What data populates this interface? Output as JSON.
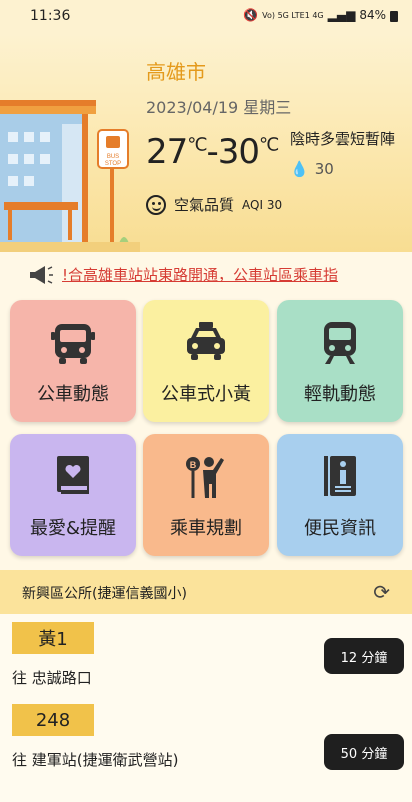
{
  "status_bar": {
    "time": "11:36",
    "signal_text": "Vo) 5G LTE1 4G",
    "battery": "84%"
  },
  "weather": {
    "city": "高雄市",
    "date": "2023/04/19 星期三",
    "temp_low": "27",
    "temp_high": "30",
    "unit": "℃",
    "description": "陰時多雲短暫陣",
    "rain_chance": "30",
    "aqi_label": "空氣品質",
    "aqi_value": "AQI 30"
  },
  "illustration": {
    "bus_stop_sign": "BUS STOP"
  },
  "announcement": "!合高雄車站站東路開通，公車站區乘車指",
  "tiles": [
    {
      "label": "公車動態",
      "icon": "bus-icon",
      "color": "#f6b5aa"
    },
    {
      "label": "公車式小黃",
      "icon": "taxi-icon",
      "color": "#fbf0a0"
    },
    {
      "label": "輕軌動態",
      "icon": "train-icon",
      "color": "#a9dfc6"
    },
    {
      "label": "最愛&提醒",
      "icon": "favorite-book-icon",
      "color": "#c9b6ef"
    },
    {
      "label": "乘車規劃",
      "icon": "trip-planner-icon",
      "color": "#f9b98c"
    },
    {
      "label": "便民資訊",
      "icon": "info-book-icon",
      "color": "#a8cfee"
    }
  ],
  "stop": {
    "name": "新興區公所(捷運信義國小)",
    "refresh_icon": "refresh-icon"
  },
  "routes": [
    {
      "route": "黃1",
      "destination": "往 忠誠路口",
      "eta": "12 分鐘"
    },
    {
      "route": "248",
      "destination": "往 建軍站(捷運衛武營站)",
      "eta": "50 分鐘"
    }
  ]
}
